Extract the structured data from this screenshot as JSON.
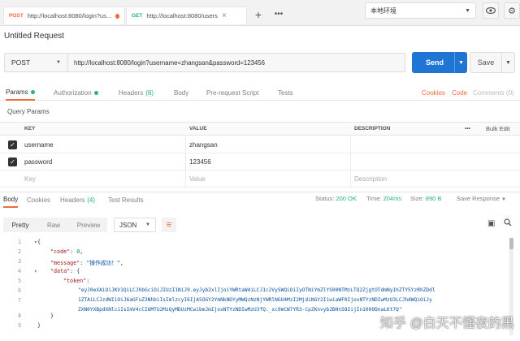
{
  "tabs": [
    {
      "method": "POST",
      "url": "http://localhost:8080/login?us...",
      "method_color": "#f26b3a"
    },
    {
      "method": "GET",
      "url": "http://localhost:8080/users",
      "method_color": "#26b47f"
    }
  ],
  "env": {
    "selected": "本地环境"
  },
  "request": {
    "title": "Untitled Request",
    "method": "POST",
    "url": "http://localhost:8080/login?username=zhangsan&password=123456",
    "send_label": "Send",
    "save_label": "Save"
  },
  "request_tabs": {
    "params": "Params",
    "authorization": "Authorization",
    "headers": "Headers",
    "headers_count": "(8)",
    "body": "Body",
    "prerequest": "Pre-request Script",
    "tests": "Tests",
    "cookies": "Cookies",
    "code": "Code",
    "comments": "Comments (0)"
  },
  "query_params": {
    "section_label": "Query Params",
    "columns": {
      "key": "KEY",
      "value": "VALUE",
      "description": "DESCRIPTION"
    },
    "more": "•••",
    "bulk_edit": "Bulk Edit",
    "rows": [
      {
        "key": "username",
        "value": "zhangsan",
        "checked": true
      },
      {
        "key": "password",
        "value": "123456",
        "checked": true
      }
    ],
    "placeholders": {
      "key": "Key",
      "value": "Value",
      "description": "Description"
    }
  },
  "response_tabs": {
    "body": "Body",
    "cookies": "Cookies",
    "headers": "Headers",
    "headers_count": "(4)",
    "test_results": "Test Results"
  },
  "response_status": {
    "status_label": "Status:",
    "status_value": "200 OK",
    "time_label": "Time:",
    "time_value": "204ms",
    "size_label": "Size:",
    "size_value": "890 B",
    "save_response": "Save Response"
  },
  "view_modes": {
    "pretty": "Pretty",
    "raw": "Raw",
    "preview": "Preview",
    "format": "JSON"
  },
  "code_lines": {
    "l1": "{",
    "l2_key": "\"code\"",
    "l2_val": "0",
    "l3_key": "\"message\"",
    "l3_val": "\"操作成功！\"",
    "l4_key": "\"data\"",
    "l4_rest": "{",
    "l5_key": "\"token\"",
    "l6": "\"eyJ0eXAiOiJKV1QiLCJhbGciOiJIUzI1NiJ9.eyJyb2xlIjoiYWRtaW4iLCJ1c2VySWQiOiIyOTNiYmZlYS00NTMzLTQ2ZjgtOTdmNy1hZTY5YzRhZDdl",
    "l7": "1ZTAiLCJzdWIiOiJ6aGFuZ3NhbiIsImlzcyI6IjA5OGY2YmNkNDYyMWQzNzNjYWRlNGU4MzI2MjdiNGY2IiwiaWF0IjoxNTYzNDIwMzU3LCJhdWQiOiJy",
    "l8": "ZXN0YXBpdXNlciIsImV4cCI6MTU2MzQyMDUzMCwibmJmIjoxNTYzNDIwMzU3fQ._xc9mCW7YR3-CpZKnvyb2BHn58IijIn1009DnaLKt7Q\"",
    "l9": "}",
    "l10": "}",
    "line_numbers": [
      "1",
      "2",
      "3",
      "4",
      "5",
      "6",
      "7",
      "",
      "",
      "8",
      "9"
    ]
  },
  "watermark": "知乎 @白天不懂夜的黑",
  "icons": {
    "close": "close-icon",
    "add": "plus-icon",
    "more": "more-icon",
    "eye": "eye-icon",
    "gear": "gear-icon",
    "caret": "chevron-down-icon",
    "check": "check-icon",
    "copy": "copy-icon",
    "search": "search-icon",
    "wrap": "wrap-lines-icon"
  },
  "colors": {
    "accent": "#f26b3a",
    "send": "#1f75d4",
    "success": "#26b47f"
  }
}
